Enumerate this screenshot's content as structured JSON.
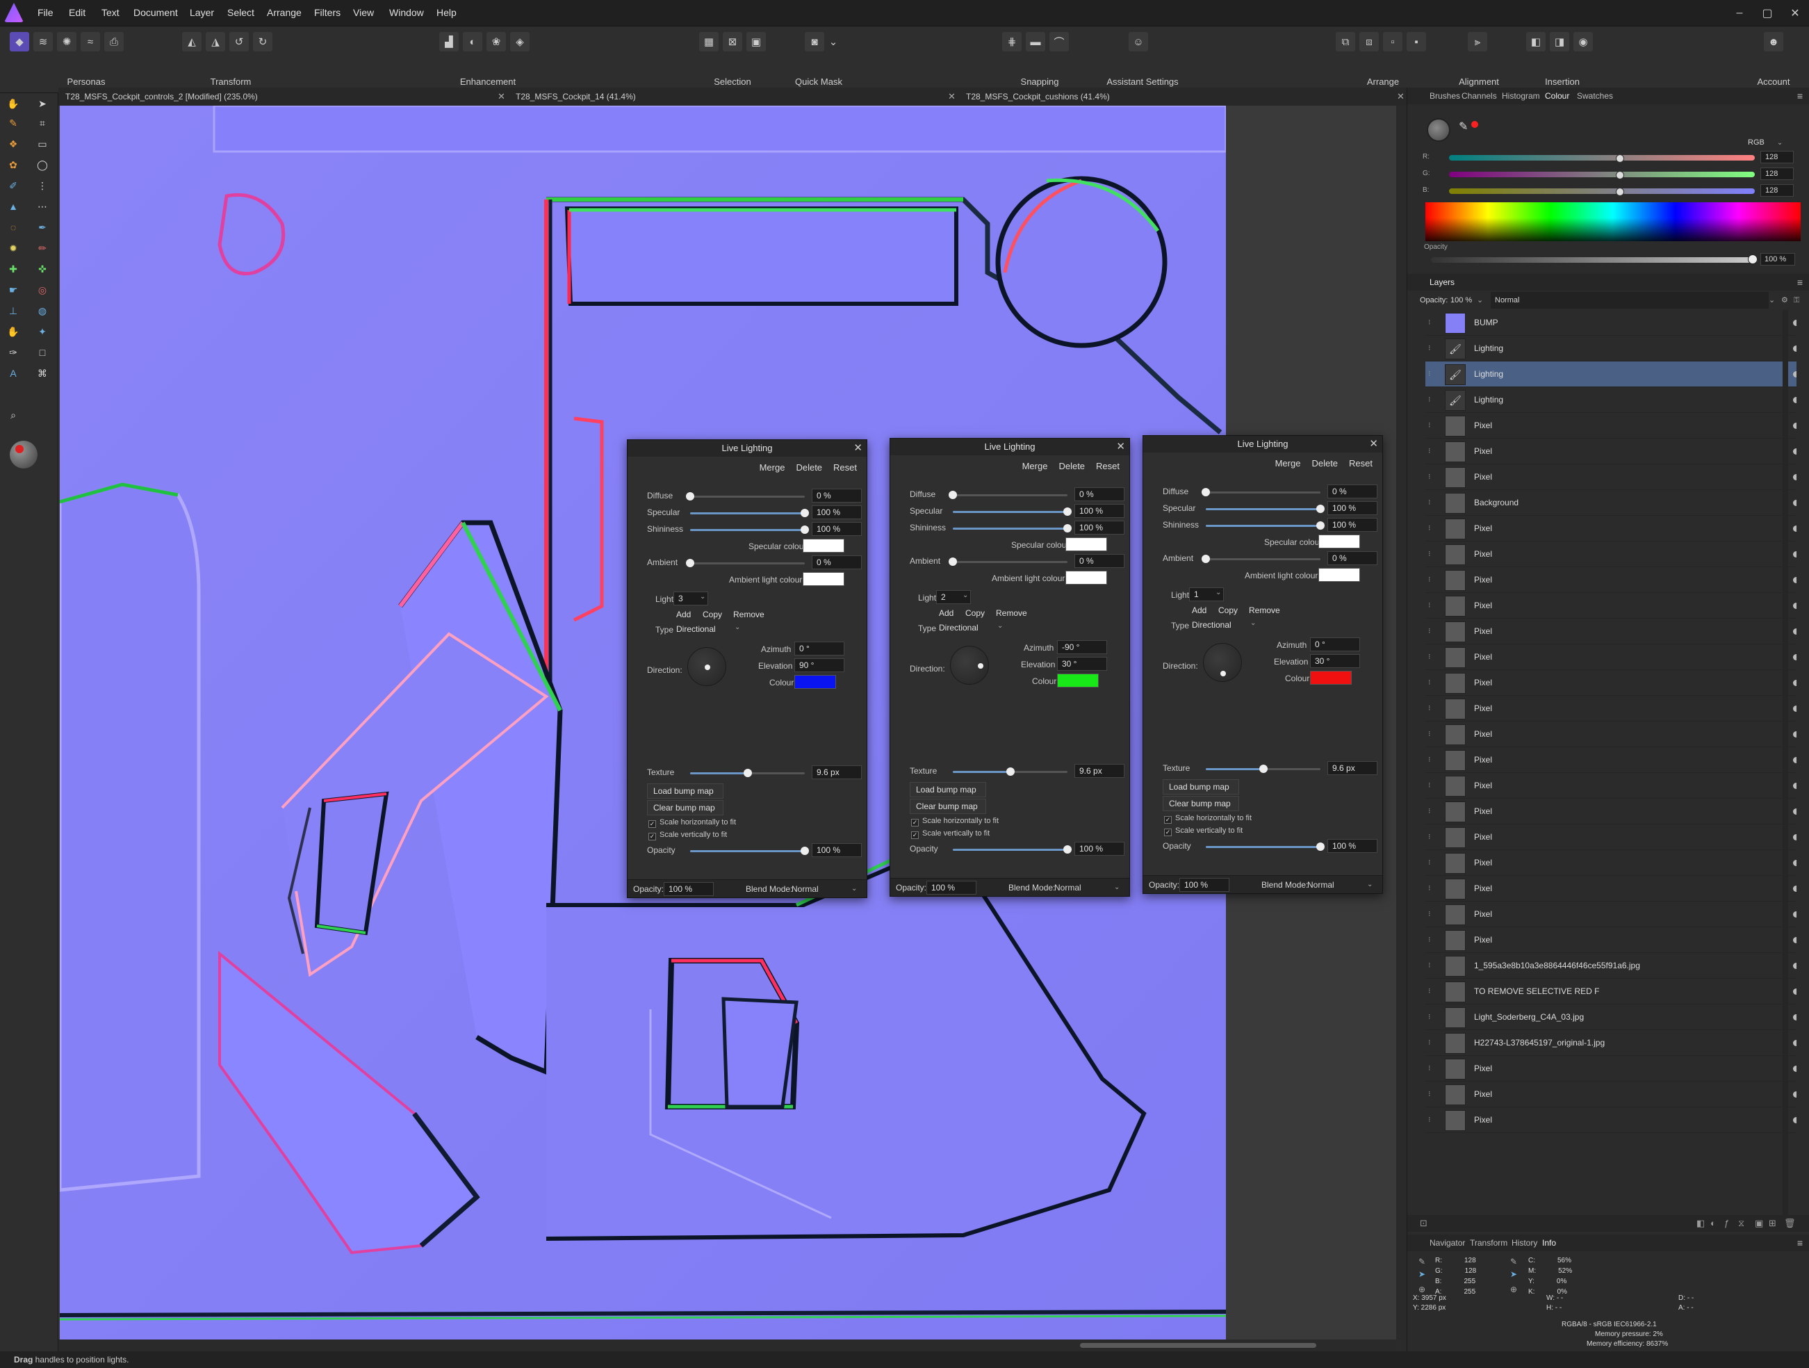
{
  "app": {
    "colors": {
      "accent": "#4a6185",
      "doc_bg": "#8680f6"
    }
  },
  "menus": [
    "File",
    "Edit",
    "Text",
    "Document",
    "Layer",
    "Select",
    "Arrange",
    "Filters",
    "View",
    "Window",
    "Help"
  ],
  "toolbar": {
    "groups": [
      "Personas",
      "Transform",
      "Enhancement",
      "Selection",
      "Quick Mask",
      "Snapping",
      "Assistant Settings",
      "Arrange",
      "Alignment",
      "Insertion",
      "Account"
    ]
  },
  "doc_tabs": [
    {
      "label": "T28_MSFS_Cockpit_controls_2 [Modified] (235.0%)"
    },
    {
      "label": "T28_MSFS_Cockpit_14 (41.4%)"
    },
    {
      "label": "T28_MSFS_Cockpit_cushions (41.4%)"
    }
  ],
  "live_lighting": {
    "title": "Live Lighting",
    "buttons": {
      "merge": "Merge",
      "delete": "Delete",
      "reset": "Reset"
    },
    "labels": {
      "diffuse": "Diffuse",
      "specular": "Specular",
      "shininess": "Shininess",
      "specular_colour": "Specular colour",
      "ambient": "Ambient",
      "ambient_light_colour": "Ambient light colour",
      "light": "Light",
      "add": "Add",
      "copy": "Copy",
      "remove": "Remove",
      "type": "Type",
      "direction": "Direction:",
      "azimuth": "Azimuth",
      "elevation": "Elevation",
      "colour": "Colour",
      "texture": "Texture",
      "load_bump": "Load bump map",
      "clear_bump": "Clear bump map",
      "scale_h": "Scale horizontally to fit",
      "scale_v": "Scale vertically to fit",
      "opacity": "Opacity",
      "opacity_foot": "Opacity:",
      "blend_mode": "Blend Mode:"
    },
    "dialogs": [
      {
        "diffuse": "0 %",
        "specular": "100 %",
        "shininess": "100 %",
        "ambient": "0 %",
        "light": "3",
        "type": "Directional",
        "azimuth": "0 °",
        "elevation": "90 °",
        "light_colour": "#0a14f0",
        "texture": "9.6 px",
        "opacity": "100 %",
        "footer_opacity": "100 %",
        "blend": "Normal",
        "diffuse_v": 0,
        "specular_v": 1,
        "shininess_v": 1,
        "ambient_v": 0,
        "texture_v": 0.5,
        "opacity_v": 1
      },
      {
        "diffuse": "0 %",
        "specular": "100 %",
        "shininess": "100 %",
        "ambient": "0 %",
        "light": "2",
        "type": "Directional",
        "azimuth": "-90 °",
        "elevation": "30 °",
        "light_colour": "#18e818",
        "texture": "9.6 px",
        "opacity": "100 %",
        "footer_opacity": "100 %",
        "blend": "Normal",
        "diffuse_v": 0,
        "specular_v": 1,
        "shininess_v": 1,
        "ambient_v": 0,
        "texture_v": 0.5,
        "opacity_v": 1
      },
      {
        "diffuse": "0 %",
        "specular": "100 %",
        "shininess": "100 %",
        "ambient": "0 %",
        "light": "1",
        "type": "Directional",
        "azimuth": "0 °",
        "elevation": "30 °",
        "light_colour": "#f01010",
        "texture": "9.6 px",
        "opacity": "100 %",
        "footer_opacity": "100 %",
        "blend": "Normal",
        "diffuse_v": 0,
        "specular_v": 1,
        "shininess_v": 1,
        "ambient_v": 0,
        "texture_v": 0.5,
        "opacity_v": 1
      }
    ]
  },
  "colour_panel": {
    "tabs": [
      "Brushes",
      "Channels",
      "Histogram",
      "Colour",
      "Swatches"
    ],
    "active": "Colour",
    "model": "RGB",
    "r_label": "R:",
    "g_label": "G:",
    "b_label": "B:",
    "r": "128",
    "g": "128",
    "b": "128",
    "opacity_label": "Opacity",
    "opacity": "100 %"
  },
  "layers_panel": {
    "title": "Layers",
    "opacity_label": "Opacity:",
    "opacity": "100 %",
    "blend": "Normal",
    "layers": [
      {
        "name": "BUMP"
      },
      {
        "name": "Lighting"
      },
      {
        "name": "Lighting",
        "selected": true
      },
      {
        "name": "Lighting"
      },
      {
        "name": "Pixel"
      },
      {
        "name": "Pixel"
      },
      {
        "name": "Pixel"
      },
      {
        "name": "Background"
      },
      {
        "name": "Pixel"
      },
      {
        "name": "Pixel"
      },
      {
        "name": "Pixel"
      },
      {
        "name": "Pixel"
      },
      {
        "name": "Pixel"
      },
      {
        "name": "Pixel"
      },
      {
        "name": "Pixel"
      },
      {
        "name": "Pixel"
      },
      {
        "name": "Pixel"
      },
      {
        "name": "Pixel"
      },
      {
        "name": "Pixel"
      },
      {
        "name": "Pixel"
      },
      {
        "name": "Pixel"
      },
      {
        "name": "Pixel"
      },
      {
        "name": "Pixel"
      },
      {
        "name": "Pixel"
      },
      {
        "name": "Pixel"
      },
      {
        "name": "1_595a3e8b10a3e8864446f46ce55f91a6.jpg"
      },
      {
        "name": "TO REMOVE SELECTIVE RED F"
      },
      {
        "name": "Light_Soderberg_C4A_03.jpg"
      },
      {
        "name": "H22743-L378645197_original-1.jpg"
      },
      {
        "name": "Pixel"
      },
      {
        "name": "Pixel"
      },
      {
        "name": "Pixel"
      }
    ]
  },
  "info_panel": {
    "tabs": [
      "Navigator",
      "Transform",
      "History",
      "Info"
    ],
    "active": "Info",
    "rgba": [
      {
        "k": "R:",
        "v": "128"
      },
      {
        "k": "G:",
        "v": "128"
      },
      {
        "k": "B:",
        "v": "255"
      },
      {
        "k": "A:",
        "v": "255"
      }
    ],
    "cmyk": [
      {
        "k": "C:",
        "v": "56%"
      },
      {
        "k": "M:",
        "v": "52%"
      },
      {
        "k": "Y:",
        "v": "0%"
      },
      {
        "k": "K:",
        "v": "0%"
      }
    ],
    "x": "X: 3957 px",
    "y": "Y: 2286 px",
    "w": "W: - -",
    "h": "H: - -",
    "d": "D: - -",
    "a": "A: - -",
    "colour_format": "RGBA/8 - sRGB IEC61966-2.1",
    "memory_pressure": "Memory pressure: 2%",
    "memory_efficiency": "Memory efficiency: 8637%"
  },
  "status": {
    "bold": "Drag",
    "text": " handles to position lights."
  }
}
